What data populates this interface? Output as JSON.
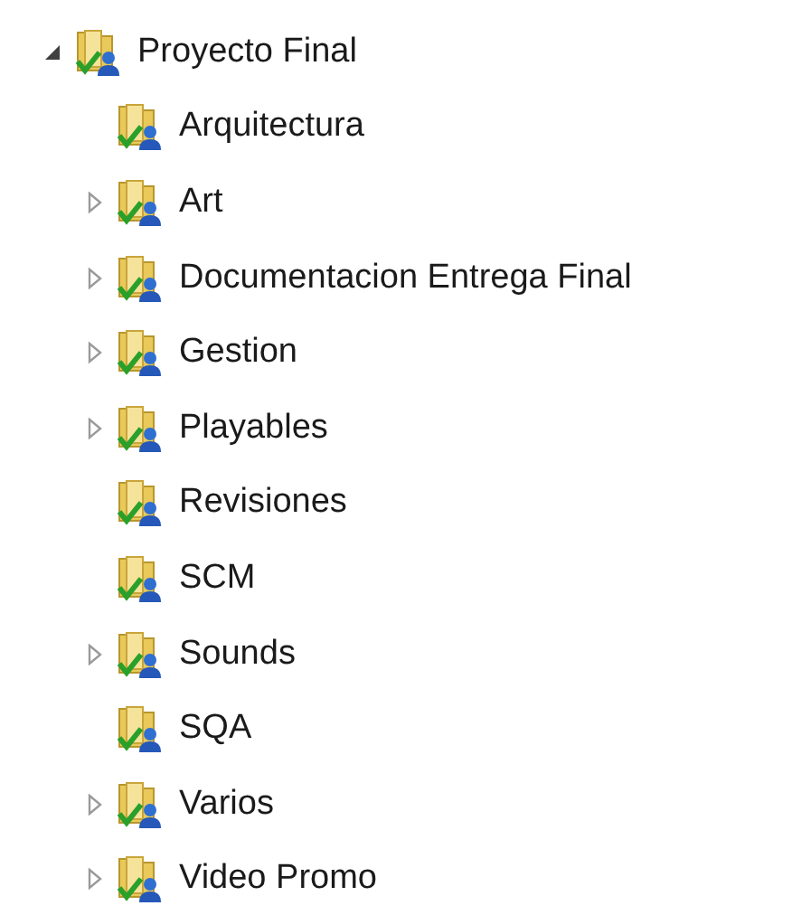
{
  "tree": [
    {
      "label": "Proyecto Final",
      "expanded": true,
      "children": [
        {
          "label": "Arquitectura"
        },
        {
          "label": "Art",
          "expanded": false
        },
        {
          "label": "Documentacion Entrega Final",
          "expanded": false
        },
        {
          "label": "Gestion",
          "expanded": false
        },
        {
          "label": "Playables",
          "expanded": false
        },
        {
          "label": "Revisiones"
        },
        {
          "label": "SCM"
        },
        {
          "label": "Sounds",
          "expanded": false
        },
        {
          "label": "SQA"
        },
        {
          "label": "Varios",
          "expanded": false
        },
        {
          "label": "Video Promo",
          "expanded": false
        }
      ]
    }
  ]
}
